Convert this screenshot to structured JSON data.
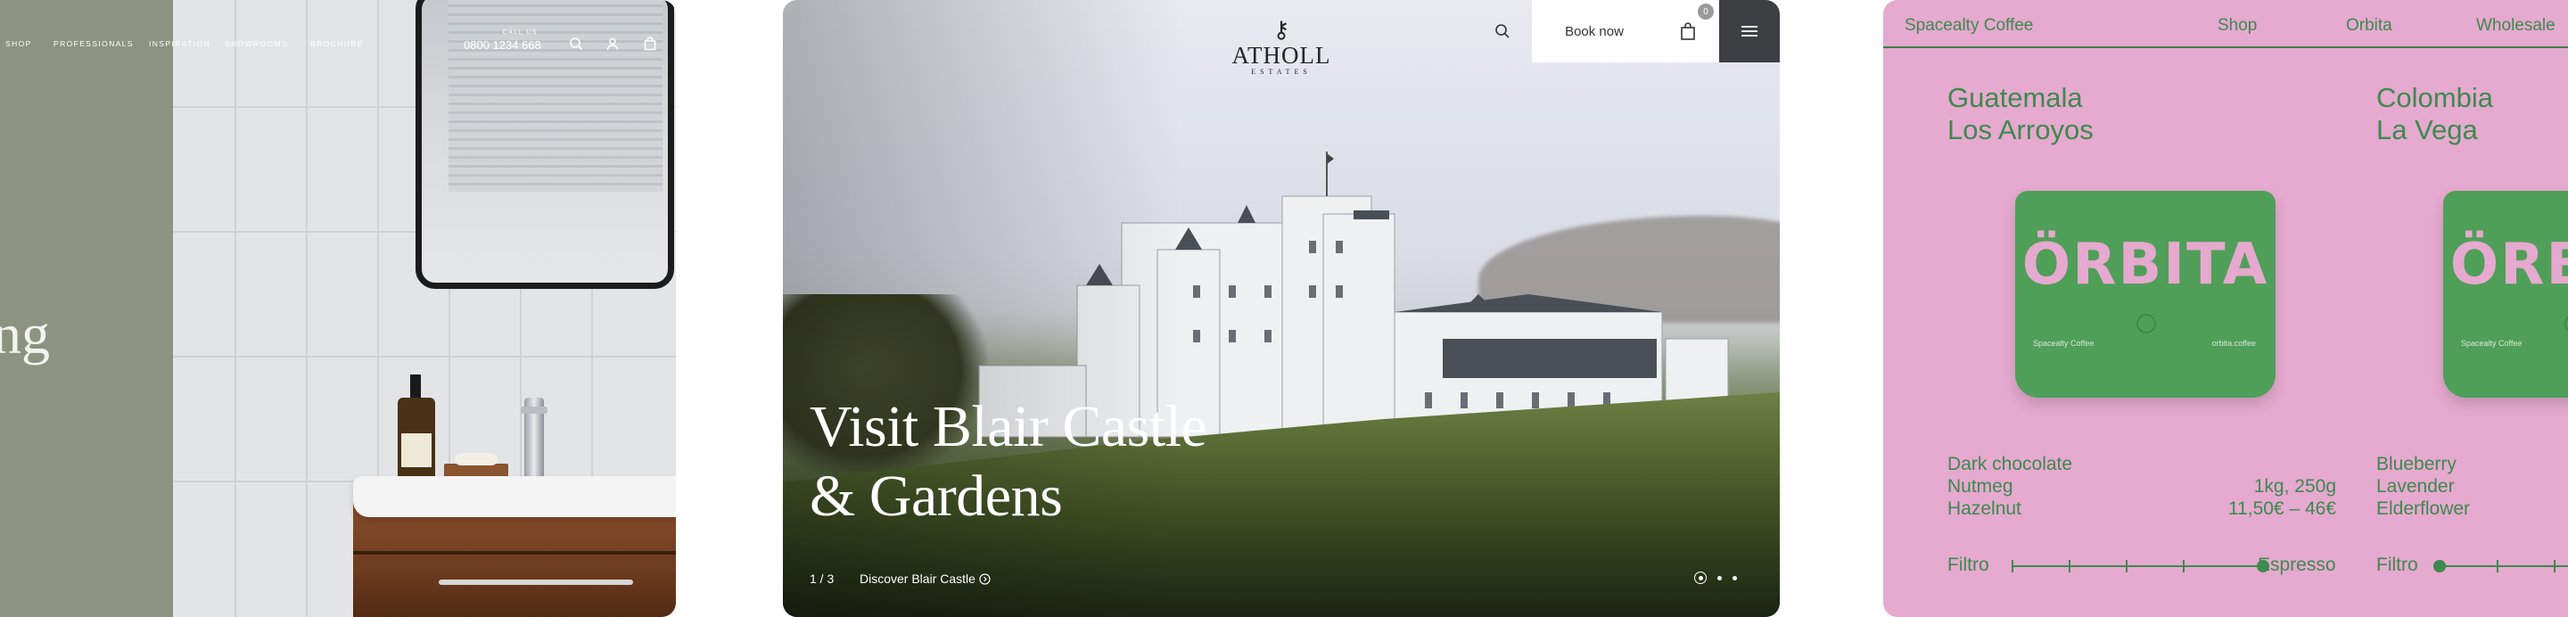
{
  "showroom": {
    "nav": [
      "SHOP",
      "PROFESSIONALS",
      "INSPIRATION",
      "SHOWROOMS",
      "BROCHURE"
    ],
    "call_label": "CALL US",
    "phone": "0800 1234 668",
    "headline_fragment": "ng",
    "icons": [
      "search-icon",
      "account-icon",
      "bag-icon"
    ],
    "colors": {
      "panel": "#8e9381",
      "tiles": "#e2e4e6",
      "wood": "#7a4524"
    }
  },
  "atholl": {
    "logo_text": "ATHOLL",
    "logo_sub": "ESTATES",
    "book_label": "Book now",
    "cart_count": "0",
    "title_line1": "Visit Blair Castle",
    "title_line2": "& Gardens",
    "slide_counter": "1 / 3",
    "discover_label": "Discover Blair Castle",
    "slides_total": 3,
    "active_slide": 1,
    "colors": {
      "menu_bg": "#3d3f42"
    }
  },
  "coffee": {
    "nav": [
      "Spacealty Coffee",
      "Shop",
      "Orbita",
      "Wholesale"
    ],
    "bag_word": "ÖRBITA",
    "bag_small_left": "Spacealty Coffee",
    "bag_small_right": "orbita.coffee",
    "products": [
      {
        "name_line1": "Guatemala",
        "name_line2": "Los Arroyos",
        "notes": [
          "Dark chocolate",
          "Nutmeg",
          "Hazelnut"
        ],
        "weight": "1kg, 250g",
        "price": "11,50€ – 46€",
        "scale_left": "Filtro",
        "scale_right": "Espresso",
        "roast_position": 1.0
      },
      {
        "name_line1": "Colombia",
        "name_line2": "La Vega",
        "notes": [
          "Blueberry",
          "Lavender",
          "Elderflower"
        ],
        "scale_left": "Filtro",
        "roast_position": 0.0
      }
    ],
    "colors": {
      "background": "#e6a9cf",
      "green": "#3c8a4d",
      "bag": "#4f9f58"
    }
  }
}
